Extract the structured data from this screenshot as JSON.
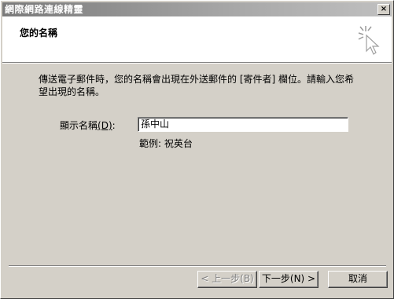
{
  "window": {
    "title": "網際網路連線精靈",
    "close_glyph": "×"
  },
  "header": {
    "title": "您的名稱"
  },
  "content": {
    "description": "傳送電子郵件時，您的名稱會出現在外送郵件的 [寄件者] 欄位。請輸入您希望出現的名稱。",
    "display_name_label": "顯示名稱",
    "display_name_accel": "(D)",
    "display_name_suffix": ":",
    "display_name_value": "孫中山",
    "example_text": "範例: 祝英台"
  },
  "buttons": {
    "back": "< 上一步(B)",
    "next": "下一步(N) >",
    "cancel": "取消"
  },
  "icons": {
    "wizard": "cursor-sparkle-icon"
  }
}
